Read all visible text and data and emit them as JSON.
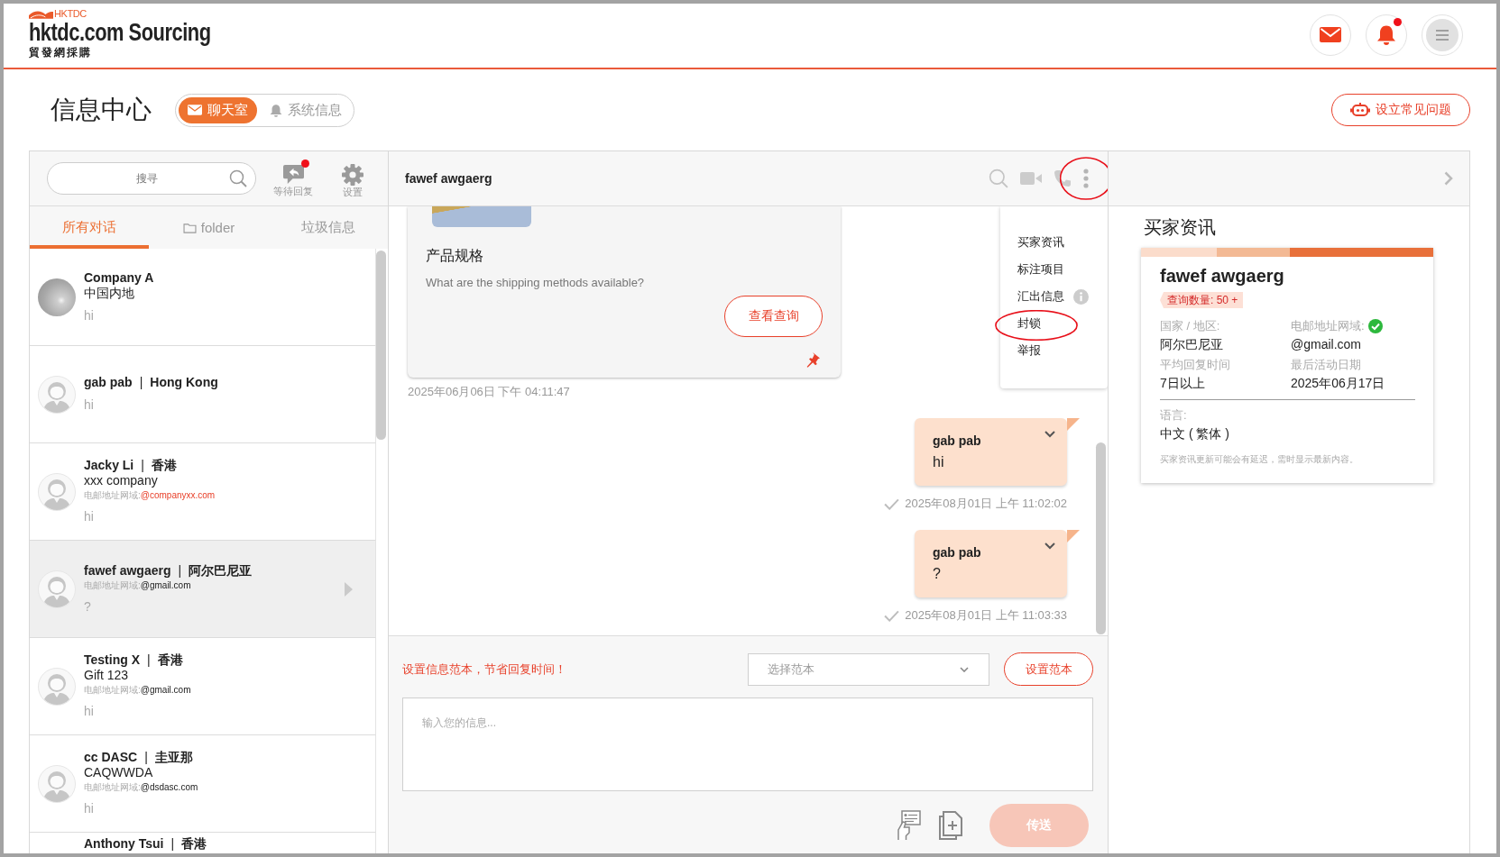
{
  "header": {
    "logo": {
      "brand": "HKTDC",
      "title": "hktdc.com Sourcing",
      "subtitle": "貿發網採購"
    },
    "bell": {
      "unread": true
    }
  },
  "page": {
    "title": "信息中心",
    "modes": [
      {
        "label": "聊天室",
        "kind": "chat",
        "selected": true
      },
      {
        "label": "系统信息",
        "kind": "notice",
        "selected": false
      }
    ],
    "faq_button": "设立常见问题"
  },
  "sidebar": {
    "search": {
      "placeholder": "搜寻"
    },
    "tools": [
      {
        "label": "等待回复",
        "kind": "reply",
        "unread": true
      },
      {
        "label": "设置",
        "kind": "settings",
        "unread": false
      }
    ],
    "tabs": [
      {
        "label": "所有对话",
        "kind": "text",
        "selected": true
      },
      {
        "label": "folder",
        "kind": "folder",
        "selected": false
      },
      {
        "label": "垃圾信息",
        "kind": "text",
        "selected": false
      }
    ],
    "conversations": [
      {
        "kind": "photo",
        "name": "Company A",
        "company": "中国内地",
        "message": "hi",
        "selected": false
      },
      {
        "kind": "default",
        "name": "gab pab",
        "separator": "|",
        "region": "Hong Kong",
        "message": "hi",
        "selected": false
      },
      {
        "kind": "default",
        "name": "Jacky Li",
        "separator": "|",
        "region": "香港",
        "company": "xxx company",
        "domain_label": "电邮地址网域:",
        "domain": "@companyxx.com",
        "domain_alert": true,
        "message": "hi",
        "selected": false
      },
      {
        "kind": "default",
        "name": "fawef awgaerg",
        "separator": "|",
        "region": "阿尔巴尼亚",
        "domain_label": "电邮地址网域:",
        "domain": "@gmail.com",
        "domain_alert": false,
        "message": "?",
        "selected": true
      },
      {
        "kind": "default",
        "name": "Testing X",
        "separator": "|",
        "region": "香港",
        "company": "Gift 123",
        "domain_label": "电邮地址网域:",
        "domain": "@gmail.com",
        "domain_alert": false,
        "message": "hi",
        "selected": false
      },
      {
        "kind": "default",
        "name": "cc DASC",
        "separator": "|",
        "region": "圭亚那",
        "company": "CAQWWDA",
        "domain_label": "电邮地址网域:",
        "domain": "@dsdasc.com",
        "domain_alert": false,
        "message": "hi",
        "selected": false
      },
      {
        "name": "Anthony Tsui",
        "separator": "|",
        "region": "香港",
        "selected": false
      }
    ]
  },
  "chat": {
    "title": "fawef awgaerg",
    "more_circled": true,
    "menu": [
      {
        "label": "买家资讯",
        "info": false,
        "circled": false
      },
      {
        "label": "标注项目",
        "info": false,
        "circled": false
      },
      {
        "label": "汇出信息",
        "info": true,
        "circled": false
      },
      {
        "label": "封锁",
        "info": false,
        "circled": true
      },
      {
        "label": "举报",
        "info": false,
        "circled": false
      }
    ],
    "inquiry": {
      "title": "产品规格",
      "question": "What are the shipping methods available?",
      "button": "查看查询",
      "pinned": true,
      "time": "2025年06月06日 下午 04:11:47"
    },
    "messages": [
      {
        "sender": "gab pab",
        "text": "hi",
        "delivered": true,
        "time": "2025年08月01日 上午 11:02:02"
      },
      {
        "sender": "gab pab",
        "text": "?",
        "delivered": true,
        "time": "2025年08月01日 上午 11:03:33"
      }
    ],
    "composer": {
      "tip": "设置信息范本，节省回复时间！",
      "template": {
        "placeholder": "选择范本"
      },
      "template_button": "设置范本",
      "message": {
        "placeholder": "输入您的信息..."
      },
      "send": {
        "label": "传送",
        "disabled": true
      }
    }
  },
  "buyer_panel": {
    "title": "买家资讯",
    "name": "fawef awgaerg",
    "badge": "查询数量: 50 +",
    "fields": [
      {
        "label": "国家 / 地区:",
        "value": "阿尔巴尼亚",
        "verified": false
      },
      {
        "label": "电邮地址网域:",
        "value": "@gmail.com",
        "verified": true
      },
      {
        "label": "平均回复时间",
        "value": "7日以上",
        "verified": false
      },
      {
        "label": "最后活动日期",
        "value": "2025年06月17日",
        "verified": false
      }
    ],
    "language": {
      "label": "语言:",
      "value": "中文 ( 繁体 )"
    },
    "note": "买家资讯更新可能会有延迟，需时显示最新内容。"
  }
}
